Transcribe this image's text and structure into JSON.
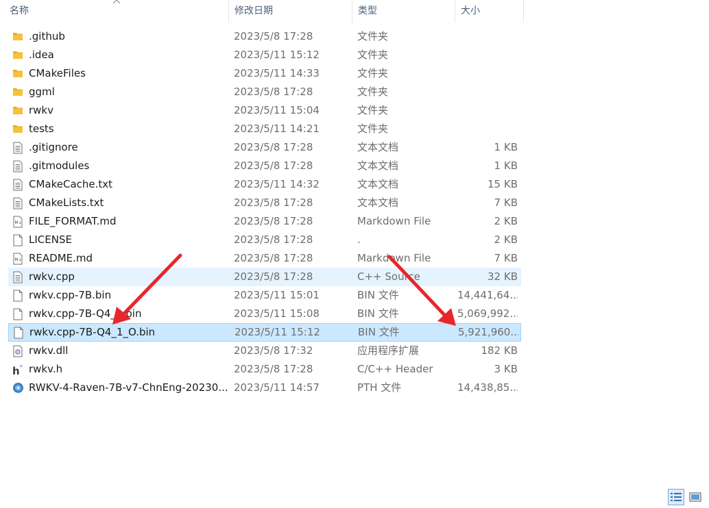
{
  "columns": {
    "name": "名称",
    "date": "修改日期",
    "type": "类型",
    "size": "大小"
  },
  "rows": [
    {
      "icon": "folder-icon",
      "name": ".github",
      "date": "2023/5/8 17:28",
      "type": "文件夹",
      "size": "",
      "state": "normal"
    },
    {
      "icon": "folder-icon",
      "name": ".idea",
      "date": "2023/5/11 15:12",
      "type": "文件夹",
      "size": "",
      "state": "normal"
    },
    {
      "icon": "folder-icon",
      "name": "CMakeFiles",
      "date": "2023/5/11 14:33",
      "type": "文件夹",
      "size": "",
      "state": "normal"
    },
    {
      "icon": "folder-icon",
      "name": "ggml",
      "date": "2023/5/8 17:28",
      "type": "文件夹",
      "size": "",
      "state": "normal"
    },
    {
      "icon": "folder-icon",
      "name": "rwkv",
      "date": "2023/5/11 15:04",
      "type": "文件夹",
      "size": "",
      "state": "normal"
    },
    {
      "icon": "folder-icon",
      "name": "tests",
      "date": "2023/5/11 14:21",
      "type": "文件夹",
      "size": "",
      "state": "normal"
    },
    {
      "icon": "text-file-icon",
      "name": ".gitignore",
      "date": "2023/5/8 17:28",
      "type": "文本文档",
      "size": "1 KB",
      "state": "normal"
    },
    {
      "icon": "text-file-icon",
      "name": ".gitmodules",
      "date": "2023/5/8 17:28",
      "type": "文本文档",
      "size": "1 KB",
      "state": "normal"
    },
    {
      "icon": "text-file-icon",
      "name": "CMakeCache.txt",
      "date": "2023/5/11 14:32",
      "type": "文本文档",
      "size": "15 KB",
      "state": "normal"
    },
    {
      "icon": "text-file-icon",
      "name": "CMakeLists.txt",
      "date": "2023/5/8 17:28",
      "type": "文本文档",
      "size": "7 KB",
      "state": "normal"
    },
    {
      "icon": "markdown-file-icon",
      "name": "FILE_FORMAT.md",
      "date": "2023/5/8 17:28",
      "type": "Markdown File",
      "size": "2 KB",
      "state": "normal"
    },
    {
      "icon": "blank-file-icon",
      "name": "LICENSE",
      "date": "2023/5/8 17:28",
      "type": ".",
      "size": "2 KB",
      "state": "normal"
    },
    {
      "icon": "markdown-file-icon",
      "name": "README.md",
      "date": "2023/5/8 17:28",
      "type": "Markdown File",
      "size": "7 KB",
      "state": "normal"
    },
    {
      "icon": "text-file-icon",
      "name": "rwkv.cpp",
      "date": "2023/5/8 17:28",
      "type": "C++ Source",
      "size": "32 KB",
      "state": "hover"
    },
    {
      "icon": "blank-file-icon",
      "name": "rwkv.cpp-7B.bin",
      "date": "2023/5/11 15:01",
      "type": "BIN 文件",
      "size": "14,441,64...",
      "state": "normal"
    },
    {
      "icon": "blank-file-icon",
      "name": "rwkv.cpp-7B-Q4_0.bin",
      "date": "2023/5/11 15:08",
      "type": "BIN 文件",
      "size": "5,069,992...",
      "state": "normal"
    },
    {
      "icon": "blank-file-icon",
      "name": "rwkv.cpp-7B-Q4_1_O.bin",
      "date": "2023/5/11 15:12",
      "type": "BIN 文件",
      "size": "5,921,960...",
      "state": "selected"
    },
    {
      "icon": "dll-file-icon",
      "name": "rwkv.dll",
      "date": "2023/5/8 17:32",
      "type": "应用程序扩展",
      "size": "182 KB",
      "state": "normal"
    },
    {
      "icon": "header-file-icon",
      "name": "rwkv.h",
      "date": "2023/5/8 17:28",
      "type": "C/C++ Header",
      "size": "3 KB",
      "state": "normal"
    },
    {
      "icon": "pth-file-icon",
      "name": "RWKV-4-Raven-7B-v7-ChnEng-20230...",
      "date": "2023/5/11 14:57",
      "type": "PTH 文件",
      "size": "14,438,85...",
      "state": "normal"
    }
  ],
  "colors": {
    "selected_bg": "#cce8ff",
    "selected_border": "#99d1ff",
    "hover_bg": "#e5f3ff",
    "folder": "#f8c13a",
    "arrow": "#e8262b"
  },
  "view_buttons": [
    "details-view-icon",
    "large-icons-view-icon"
  ]
}
